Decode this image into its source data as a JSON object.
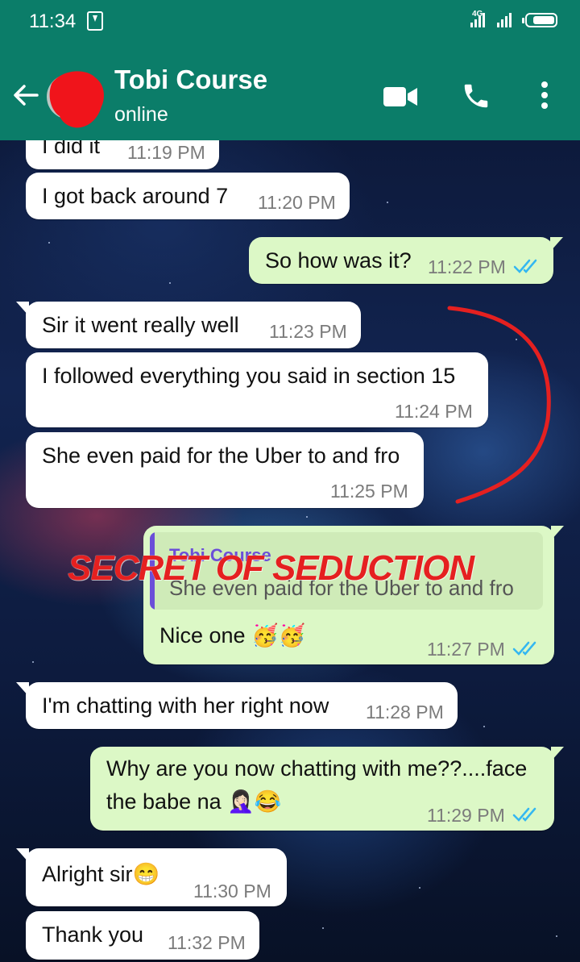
{
  "status_bar": {
    "time": "11:34",
    "network": "4G"
  },
  "header": {
    "contact_name": "Tobi Course",
    "status": "online"
  },
  "messages": [
    {
      "text": "I did it",
      "time": "11:19 PM"
    },
    {
      "text": "I got back around 7",
      "time": "11:20 PM"
    },
    {
      "text": "So how was it?",
      "time": "11:22 PM"
    },
    {
      "text": "Sir it went really well",
      "time": "11:23 PM"
    },
    {
      "text": "I followed everything you said in section 15",
      "time": "11:24 PM"
    },
    {
      "text": "She even paid for the Uber to and fro",
      "time": "11:25 PM"
    },
    {
      "quote_name": "Tobi Course",
      "quote_text": "She even paid for the Uber to and fro",
      "text": "Nice one",
      "emoji": "🥳🥳",
      "time": "11:27 PM"
    },
    {
      "text": "I'm chatting with her right now",
      "time": "11:28 PM"
    },
    {
      "text_line1": "Why are you now chatting with me??....face",
      "text_line2": "the babe na",
      "emoji": "🤦🏻‍♀️😂",
      "time": "11:29 PM"
    },
    {
      "text": "Alright sir",
      "emoji": "😁",
      "time": "11:30 PM"
    },
    {
      "text": "Thank you",
      "time": "11:32 PM"
    }
  ],
  "watermark": "SECRET OF SEDUCTION",
  "colors": {
    "header": "#0b7d69",
    "outgoing_bubble": "#dcf8c6",
    "incoming_bubble": "#ffffff",
    "read_ticks": "#34b7f1",
    "annotation": "#e52020"
  }
}
